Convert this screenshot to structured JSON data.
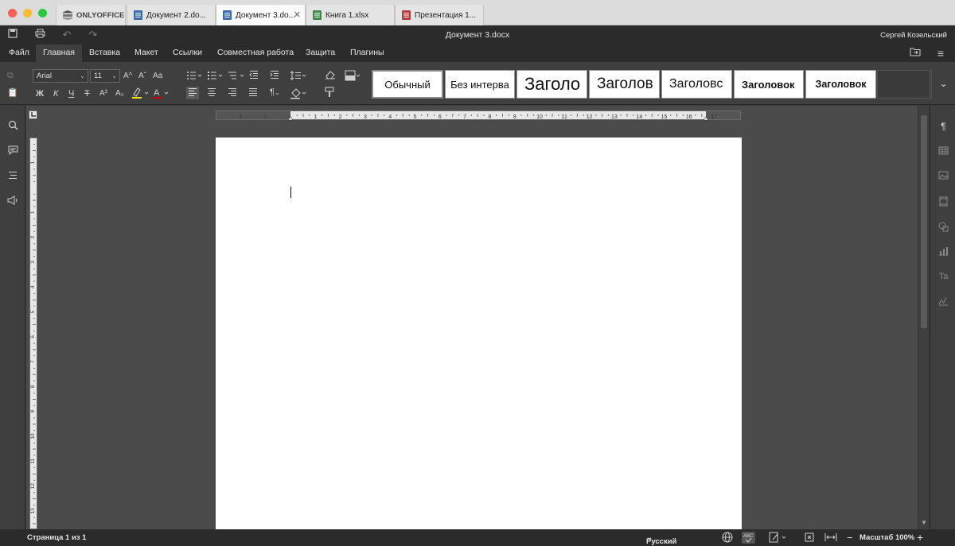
{
  "tabs": [
    {
      "label": "ONLYOFFICE",
      "icon": "onlyoffice-logo-icon"
    },
    {
      "label": "Документ 2.do...",
      "icon": "document-icon",
      "color": "#3b6aa8"
    },
    {
      "label": "Документ 3.do...",
      "icon": "document-icon",
      "color": "#3b6aa8",
      "active": true,
      "close": "✕"
    },
    {
      "label": "Книга 1.xlsx",
      "icon": "spreadsheet-icon",
      "color": "#3b8a4a"
    },
    {
      "label": "Презентация 1...",
      "icon": "presentation-icon",
      "color": "#b83a3a"
    }
  ],
  "window": {
    "title": "Документ 3.docx",
    "user": "Сергей Козельский"
  },
  "menu": [
    "Файл",
    "Главная",
    "Вставка",
    "Макет",
    "Ссылки",
    "Совместная работа",
    "Защита",
    "Плагины"
  ],
  "menu_active": "Главная",
  "font": {
    "name": "Arial",
    "size": "11"
  },
  "format": {
    "bold": "Ж",
    "italic": "К",
    "underline": "Ч",
    "strike": "Т",
    "superscript": "A²",
    "subscript": "A₂",
    "increase": "A^",
    "decrease": "Aˇ",
    "case": "Aa"
  },
  "styles": [
    {
      "label": "Обычный",
      "size": "13px",
      "weight": "normal"
    },
    {
      "label": "Без интерва",
      "size": "13px",
      "weight": "normal"
    },
    {
      "label": "Заголо",
      "size": "22px",
      "weight": "normal"
    },
    {
      "label": "Заголов",
      "size": "19px",
      "weight": "normal"
    },
    {
      "label": "Заголовс",
      "size": "16px",
      "weight": "normal"
    },
    {
      "label": "Заголовок",
      "size": "13px",
      "weight": "bold"
    },
    {
      "label": "Заголовок",
      "size": "12.5px",
      "weight": "bold"
    }
  ],
  "ruler": {
    "h_labels": [
      "2",
      "1",
      "1",
      "2",
      "3",
      "4",
      "5",
      "6",
      "7",
      "8",
      "9",
      "10",
      "11",
      "12",
      "13",
      "14",
      "15",
      "16",
      "17"
    ],
    "v_labels": [
      "1",
      "1",
      "2",
      "3",
      "4",
      "5",
      "6",
      "7",
      "8",
      "9",
      "10",
      "11",
      "12",
      "13"
    ]
  },
  "status": {
    "page": "Страница 1 из 1",
    "language": "Русский (Россия)",
    "zoom": "Масштаб 100%"
  },
  "colors": {
    "accent": "#3b6aa8",
    "highlight": "#f3e600",
    "font_color": "#d00000"
  }
}
